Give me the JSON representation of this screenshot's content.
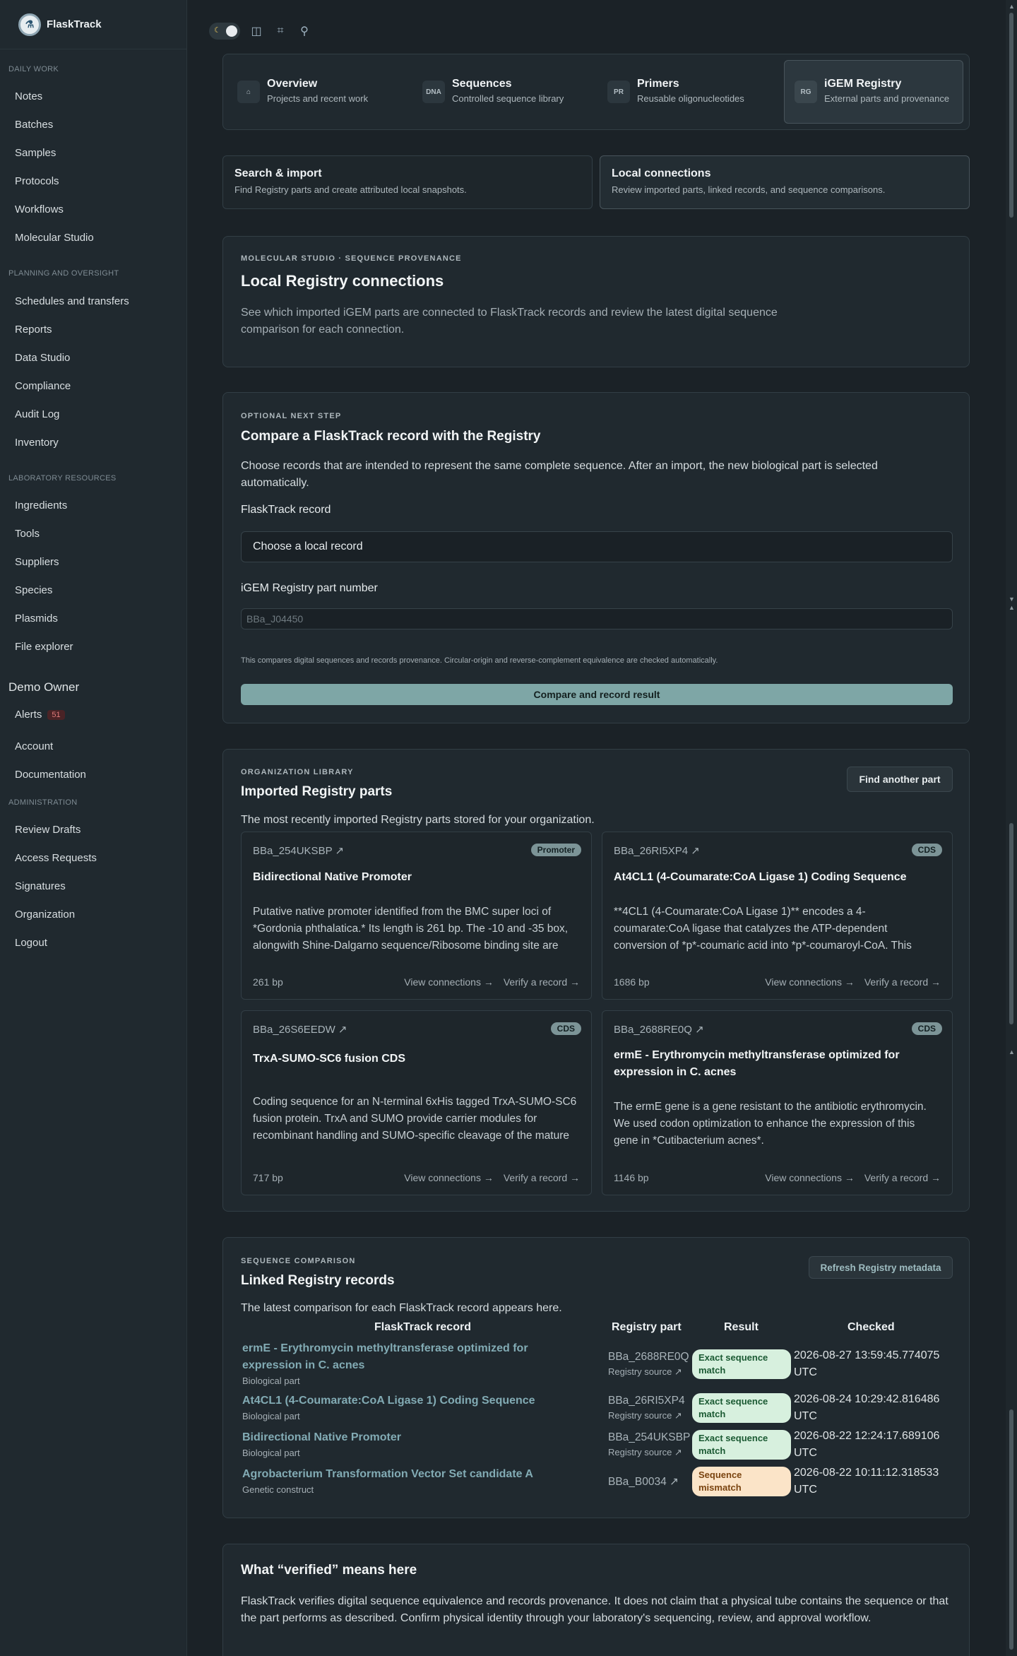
{
  "brand": {
    "name": "FlaskTrack"
  },
  "sidebar": {
    "daily_label": "DAILY WORK",
    "daily": [
      "Notes",
      "Batches",
      "Samples",
      "Protocols",
      "Workflows",
      "Molecular Studio"
    ],
    "planning_label": "PLANNING AND OVERSIGHT",
    "planning": [
      "Schedules and transfers",
      "Reports",
      "Data Studio",
      "Compliance",
      "Audit Log",
      "Inventory"
    ],
    "resources_label": "LABORATORY RESOURCES",
    "resources": [
      "Ingredients",
      "Tools",
      "Suppliers",
      "Species",
      "Plasmids",
      "File explorer"
    ],
    "owner": "Demo Owner",
    "alerts_label": "Alerts",
    "alerts_count": "51",
    "account": [
      "Account",
      "Documentation"
    ],
    "admin_label": "ADMINISTRATION",
    "admin": [
      "Review Drafts",
      "Access Requests",
      "Signatures",
      "Organization",
      "Logout"
    ]
  },
  "modules": [
    {
      "badge": "⌂",
      "title": "Overview",
      "subtitle": "Projects and recent work"
    },
    {
      "badge": "DNA",
      "title": "Sequences",
      "subtitle": "Controlled sequence library"
    },
    {
      "badge": "PR",
      "title": "Primers",
      "subtitle": "Reusable oligonucleotides"
    },
    {
      "badge": "RG",
      "title": "iGEM Registry",
      "subtitle": "External parts and provenance"
    }
  ],
  "subtabs": [
    {
      "title": "Search & import",
      "subtitle": "Find Registry parts and create attributed local snapshots."
    },
    {
      "title": "Local connections",
      "subtitle": "Review imported parts, linked records, and sequence comparisons."
    }
  ],
  "intro": {
    "eyebrow": "MOLECULAR STUDIO · SEQUENCE PROVENANCE",
    "title": "Local Registry connections",
    "body": "See which imported iGEM parts are connected to FlaskTrack records and review the latest digital sequence comparison for each connection."
  },
  "compare": {
    "eyebrow": "OPTIONAL NEXT STEP",
    "title": "Compare a FlaskTrack record with the Registry",
    "body": "Choose records that are intended to represent the same complete sequence. After an import, the new biological part is selected automatically.",
    "record_label": "FlaskTrack record",
    "record_value": "Choose a local record",
    "part_label": "iGEM Registry part number",
    "part_placeholder": "BBa_J04450",
    "note": "This compares digital sequences and records provenance. Circular-origin and reverse-complement equivalence are checked automatically.",
    "button": "Compare and record result"
  },
  "library": {
    "eyebrow": "ORGANIZATION LIBRARY",
    "title": "Imported Registry parts",
    "find_button": "Find another part",
    "body": "The most recently imported Registry parts stored for your organization.",
    "view_label": "View connections →",
    "verify_label": "Verify a record →",
    "parts": [
      {
        "id": "BBa_254UKSBP ↗",
        "tag": "Promoter",
        "title": "Bidirectional Native Promoter",
        "desc": "Putative native promoter identified from the BMC super loci of *Gordonia phthalatica.* Its length is 261 bp. The -10 and -35 box, alongwith Shine-Dalgarno sequence/Ribosome binding site are annotated.",
        "bp": "261 bp"
      },
      {
        "id": "BBa_26RI5XP4 ↗",
        "tag": "CDS",
        "title": "At4CL1 (4-Coumarate:CoA Ligase 1) Coding Sequence",
        "desc": "**4CL1 (4-Coumarate:CoA Ligase 1)** encodes a 4-coumarate:CoA ligase that catalyzes the ATP-dependent conversion of *p*-coumaric acid into *p*-coumaroyl-CoA. This enzyme is part of the phenylpropanoid pathway.",
        "bp": "1686 bp"
      },
      {
        "id": "BBa_26S6EEDW ↗",
        "tag": "CDS",
        "title": "TrxA-SUMO-SC6 fusion CDS",
        "desc": "Coding sequence for an N-terminal 6xHis tagged TrxA-SUMO-SC6 fusion protein. TrxA and SUMO provide carrier modules for recombinant handling and SUMO-specific cleavage of the mature peptide.",
        "bp": "717 bp"
      },
      {
        "id": "BBa_2688RE0Q ↗",
        "tag": "CDS",
        "title": "ermE - Erythromycin methyltransferase optimized for expression in C. acnes",
        "desc": "The ermE gene is a gene resistant to the antibiotic erythromycin. We used codon optimization to enhance the expression of this gene in *Cutibacterium acnes*.",
        "bp": "1146 bp"
      }
    ]
  },
  "linked": {
    "eyebrow": "SEQUENCE COMPARISON",
    "title": "Linked Registry records",
    "refresh_button": "Refresh Registry metadata",
    "body": "The latest comparison for each FlaskTrack record appears here.",
    "columns": [
      "FlaskTrack record",
      "Registry part",
      "Result",
      "Checked"
    ],
    "rows": [
      {
        "record": "ermE - Erythromycin methyltransferase optimized for expression in C. acnes",
        "kind": "Biological part",
        "part": "BBa_2688RE0Q",
        "source": "Registry source ↗",
        "result": "Exact sequence match",
        "status": "ok",
        "checked": "2026-08-27 13:59:45.774075 UTC"
      },
      {
        "record": "At4CL1 (4-Coumarate:CoA Ligase 1) Coding Sequence",
        "kind": "Biological part",
        "part": "BBa_26RI5XP4",
        "source": "Registry source ↗",
        "result": "Exact sequence match",
        "status": "ok",
        "checked": "2026-08-24 10:29:42.816486 UTC"
      },
      {
        "record": "Bidirectional Native Promoter",
        "kind": "Biological part",
        "part": "BBa_254UKSBP",
        "source": "Registry source ↗",
        "result": "Exact sequence match",
        "status": "ok",
        "checked": "2026-08-22 12:24:17.689106 UTC"
      },
      {
        "record": "Agrobacterium Transformation Vector Set candidate A",
        "kind": "Genetic construct",
        "part": "BBa_B0034 ↗",
        "source": "",
        "result": "Sequence mismatch",
        "status": "bad",
        "checked": "2026-08-22 10:11:12.318533 UTC"
      }
    ]
  },
  "verified": {
    "title": "What “verified” means here",
    "body": "FlaskTrack verifies digital sequence equivalence and records provenance. It does not claim that a physical tube contains the sequence or that the part performs as described. Confirm physical identity through your laboratory's sequencing, review, and approval workflow."
  }
}
